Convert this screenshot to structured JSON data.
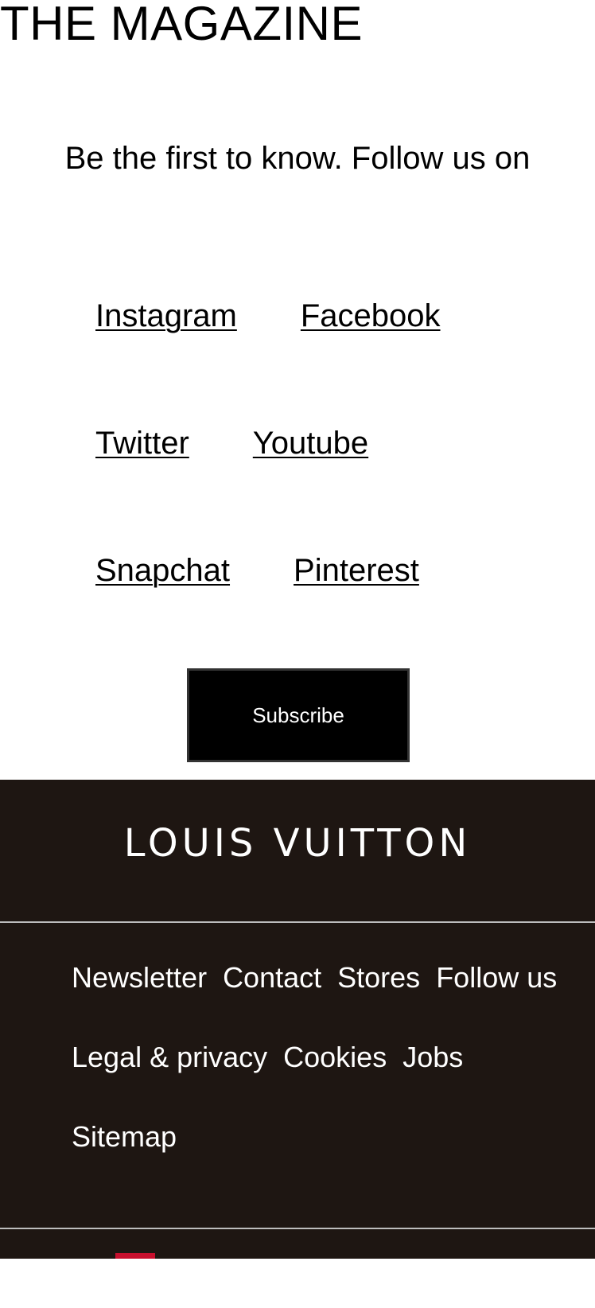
{
  "magazine": {
    "title": "THE MAGAZINE",
    "follow_text": "Be the first to know. Follow us on"
  },
  "social": {
    "instagram": "Instagram",
    "facebook": "Facebook",
    "twitter": "Twitter",
    "youtube": "Youtube",
    "snapchat": "Snapchat",
    "pinterest": "Pinterest"
  },
  "subscribe": {
    "label": "Subscribe"
  },
  "footer": {
    "brand": "LOUIS VUITTON",
    "links": [
      "Newsletter",
      "Contact",
      "Stores",
      "Follow us",
      "Legal & privacy",
      "Cookies",
      "Jobs",
      "Sitemap"
    ]
  },
  "colors": {
    "footer_bg": "#1e1612",
    "button_bg": "#000000",
    "flag_red": "#c8102e"
  }
}
